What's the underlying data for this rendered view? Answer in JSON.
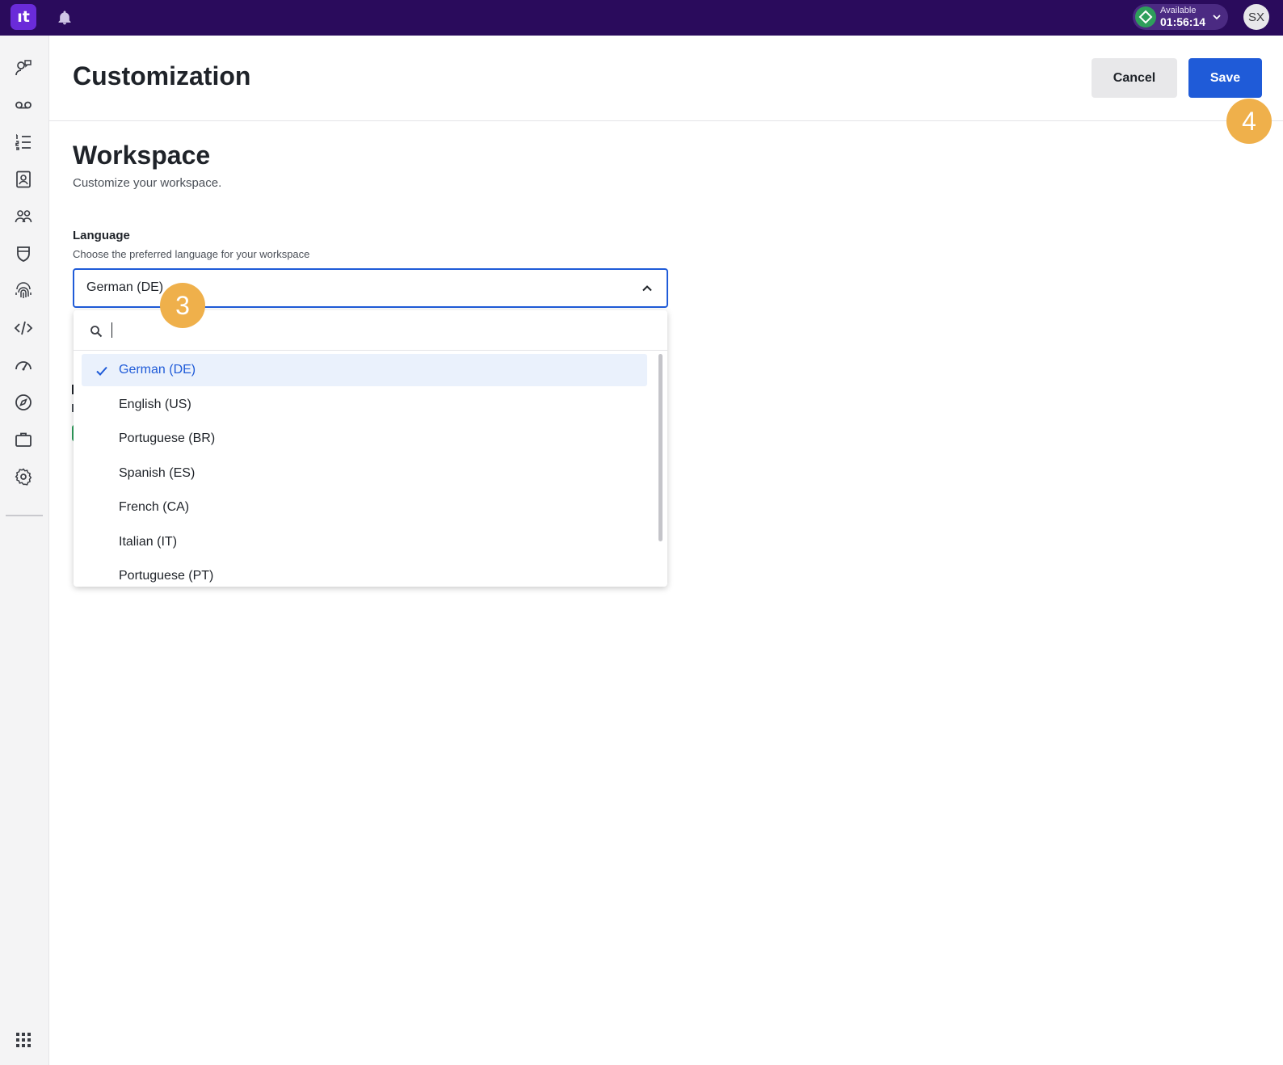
{
  "topbar": {
    "logo_text": "ıt",
    "status_label": "Available",
    "status_time": "01:56:14",
    "avatar_initials": "SX",
    "bell_icon": "bell-icon",
    "colors": {
      "bar": "#2a0b5c",
      "logo": "#6a2bd9",
      "status_dot": "#2e9e5b"
    }
  },
  "sidebar": {
    "items": [
      {
        "name": "conversations",
        "icon": "chat-user-icon"
      },
      {
        "name": "voicemail",
        "icon": "voicemail-icon"
      },
      {
        "name": "lists",
        "icon": "numbered-list-icon"
      },
      {
        "name": "contacts",
        "icon": "contact-book-icon"
      },
      {
        "name": "teams",
        "icon": "people-icon"
      },
      {
        "name": "security",
        "icon": "shield-icon"
      },
      {
        "name": "identity",
        "icon": "fingerprint-icon"
      },
      {
        "name": "developer",
        "icon": "code-icon"
      },
      {
        "name": "dashboards",
        "icon": "speedometer-icon"
      },
      {
        "name": "explore",
        "icon": "compass-icon"
      },
      {
        "name": "workspaces",
        "icon": "briefcase-icon"
      },
      {
        "name": "settings",
        "icon": "gear-icon"
      }
    ],
    "apps_icon": "apps-grid-icon"
  },
  "header": {
    "title": "Customization",
    "cancel_label": "Cancel",
    "save_label": "Save"
  },
  "workspace": {
    "title": "Workspace",
    "subtitle": "Customize your workspace.",
    "language": {
      "label": "Language",
      "help": "Choose the preferred language for your workspace",
      "selected_value": "German (DE)",
      "search_value": "",
      "options": [
        "German (DE)",
        "English (US)",
        "Portuguese (BR)",
        "Spanish (ES)",
        "French (CA)",
        "Italian (IT)",
        "Portuguese (PT)"
      ],
      "selected_index": 0
    }
  },
  "annotations": {
    "step_a": "3",
    "step_b": "4",
    "color": "#efb04b"
  }
}
